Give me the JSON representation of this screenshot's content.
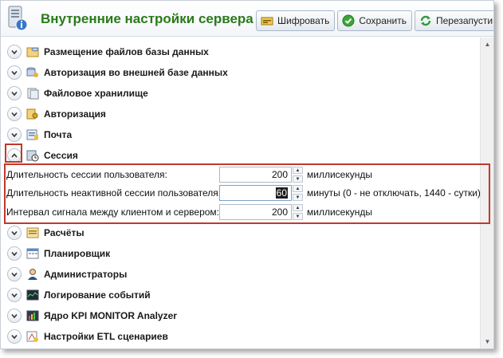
{
  "header": {
    "title": "Внутренние настройки сервера",
    "buttons": [
      {
        "label": "Шифровать",
        "icon": "encrypt-icon"
      },
      {
        "label": "Сохранить",
        "icon": "save-check-icon"
      },
      {
        "label": "Перезапусти",
        "icon": "restart-icon"
      }
    ]
  },
  "sections": [
    {
      "label": "Размещение файлов базы данных",
      "icon": "database-files-icon",
      "expanded": false
    },
    {
      "label": "Авторизация во внешней базе данных",
      "icon": "external-db-auth-icon",
      "expanded": false
    },
    {
      "label": "Файловое хранилище",
      "icon": "file-storage-icon",
      "expanded": false
    },
    {
      "label": "Авторизация",
      "icon": "authorization-icon",
      "expanded": false
    },
    {
      "label": "Почта",
      "icon": "mail-icon",
      "expanded": false
    },
    {
      "label": "Сессия",
      "icon": "session-icon",
      "expanded": true
    },
    {
      "label": "Расчёты",
      "icon": "calculations-icon",
      "expanded": false
    },
    {
      "label": "Планировщик",
      "icon": "scheduler-icon",
      "expanded": false
    },
    {
      "label": "Администраторы",
      "icon": "administrators-icon",
      "expanded": false
    },
    {
      "label": "Логирование событий",
      "icon": "event-log-icon",
      "expanded": false
    },
    {
      "label": "Ядро KPI MONITOR Analyzer",
      "icon": "analyzer-core-icon",
      "expanded": false
    },
    {
      "label": "Настройки ETL сценариев",
      "icon": "etl-settings-icon",
      "expanded": false
    }
  ],
  "session": {
    "fields": [
      {
        "label": "Длительность сессии пользователя:",
        "value": "200",
        "unit": "миллисекунды"
      },
      {
        "label": "Длительность неактивной сессии пользователя:",
        "value": "60",
        "unit": "минуты (0 - не отключать, 1440 - сутки)"
      },
      {
        "label": "Интервал сигнала между клиентом и сервером:",
        "value": "200",
        "unit": "миллисекунды"
      }
    ]
  },
  "colors": {
    "title": "#2b7a1a",
    "highlight": "#c0392b"
  }
}
